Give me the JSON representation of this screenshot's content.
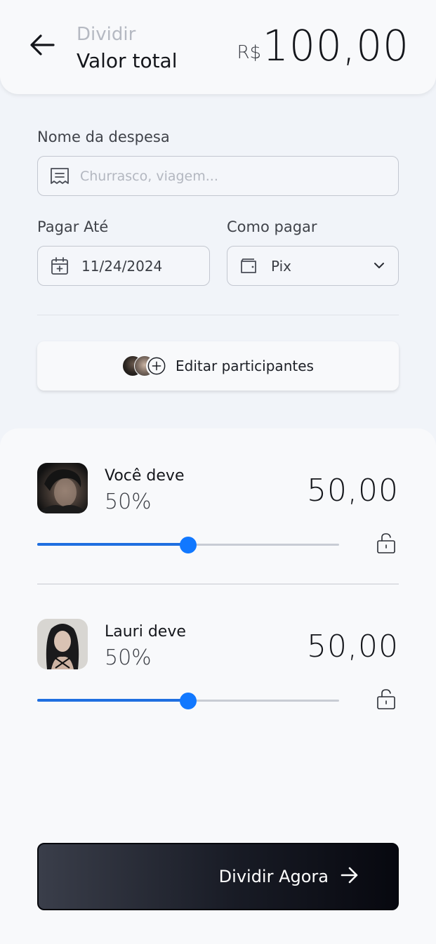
{
  "header": {
    "subtitle": "Dividir",
    "title": "Valor total",
    "currency": "R$",
    "total": "100,00"
  },
  "form": {
    "expense_label": "Nome da despesa",
    "expense_placeholder": "Churrasco, viagem...",
    "due_label": "Pagar Até",
    "due_value": "11/24/2024",
    "method_label": "Como pagar",
    "method_value": "Pix"
  },
  "participants_button": {
    "label": "Editar participantes"
  },
  "splits": [
    {
      "name": "Você deve",
      "percent": "50%",
      "amount": "50,00",
      "slider_fraction": 0.5
    },
    {
      "name": "Lauri deve",
      "percent": "50%",
      "amount": "50,00",
      "slider_fraction": 0.5
    }
  ],
  "cta": {
    "label": "Dividir Agora"
  },
  "colors": {
    "accent": "#1178ff",
    "slider_fill": "#1f6fe0",
    "cta_dark": "#07080f"
  }
}
